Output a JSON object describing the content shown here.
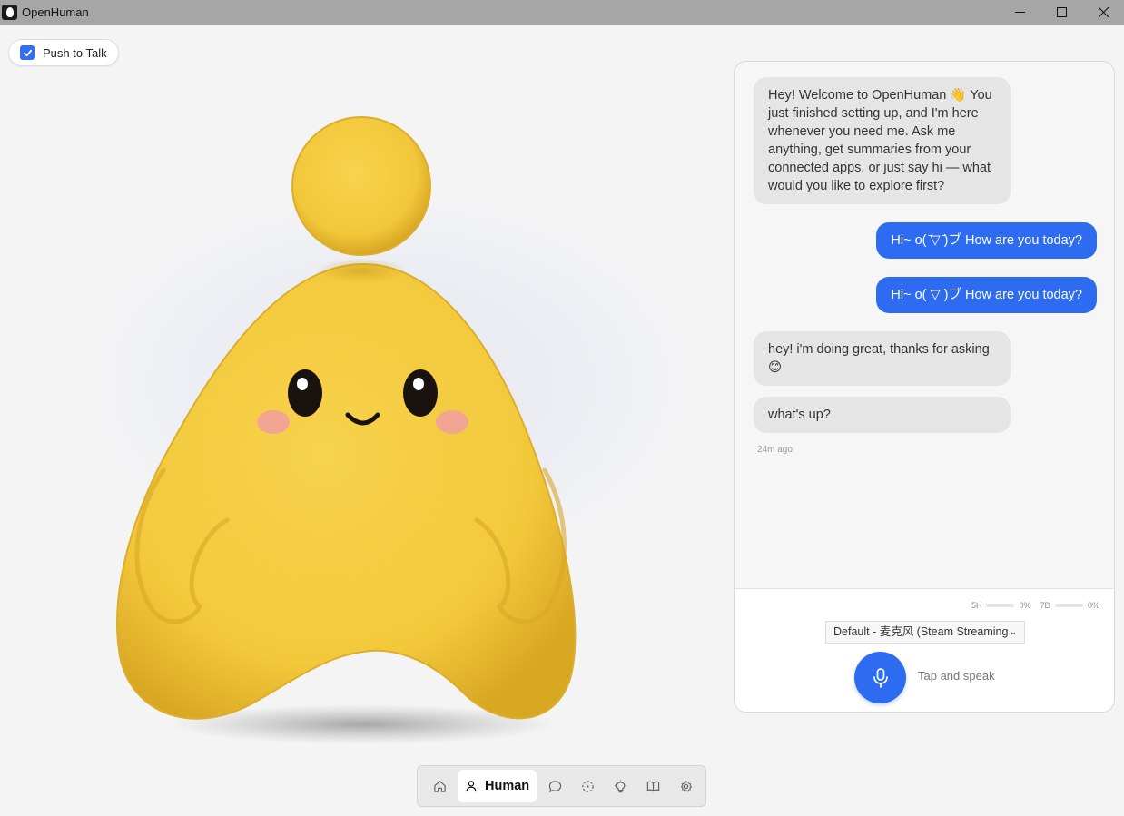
{
  "window": {
    "title": "OpenHuman"
  },
  "push_to_talk": {
    "label": "Push to Talk",
    "checked": true
  },
  "chat": {
    "messages": [
      {
        "role": "assistant",
        "text": "Hey! Welcome to OpenHuman 👋 You just finished setting up, and I'm here whenever you need me. Ask me anything, get summaries from your connected apps, or just say hi — what would you like to explore first?"
      },
      {
        "role": "user",
        "text": "Hi~ o( ̄▽ ̄)ブ How are you today?"
      },
      {
        "role": "user",
        "text": "Hi~ o( ̄▽ ̄)ブ How are you today?"
      },
      {
        "role": "assistant",
        "text": "hey! i'm doing great, thanks for asking 😊"
      },
      {
        "role": "assistant",
        "text": "what's up?"
      }
    ],
    "timestamp": "24m ago",
    "usage": [
      {
        "label": "5H",
        "percent": "0%",
        "value": 0
      },
      {
        "label": "7D",
        "percent": "0%",
        "value": 0
      }
    ],
    "input_device": "Default - 麦克风 (Steam Streaming",
    "tap_hint": "Tap and speak"
  },
  "nav": {
    "items": [
      {
        "id": "home",
        "icon": "home-icon"
      },
      {
        "id": "human",
        "icon": "user-icon",
        "label": "Human",
        "active": true
      },
      {
        "id": "chat",
        "icon": "chat-bubble-icon"
      },
      {
        "id": "integrations",
        "icon": "dashed-circle-icon"
      },
      {
        "id": "ideas",
        "icon": "lightbulb-icon"
      },
      {
        "id": "library",
        "icon": "book-icon"
      },
      {
        "id": "settings",
        "icon": "gear-icon"
      }
    ]
  },
  "colors": {
    "accent": "#2d6bf0",
    "mascot": "#f5cd45",
    "titlebar": "#a6a6a6"
  }
}
